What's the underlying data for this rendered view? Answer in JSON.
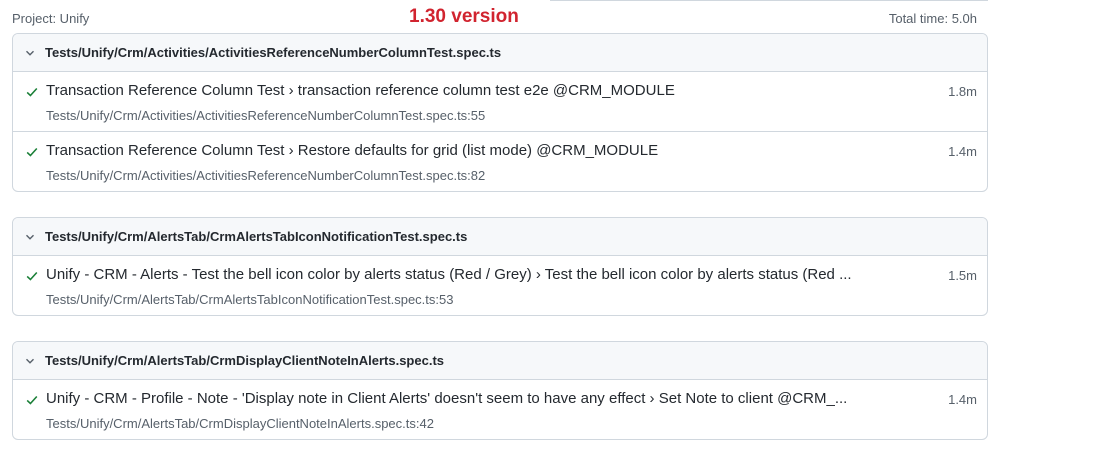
{
  "header": {
    "project": "Project: Unify",
    "version": "1.30 version",
    "total_time": "Total time: 5.0h"
  },
  "colors": {
    "pass": "#1a7f37",
    "version": "#d1242f"
  },
  "files": [
    {
      "title": "Tests/Unify/Crm/Activities/ActivitiesReferenceNumberColumnTest.spec.ts",
      "expanded_icon": "chevron-down-icon",
      "tests": [
        {
          "status_icon": "check-icon",
          "title": "Transaction Reference Column Test › transaction reference column test e2e @CRM_MODULE",
          "location": "Tests/Unify/Crm/Activities/ActivitiesReferenceNumberColumnTest.spec.ts:55",
          "duration": "1.8m"
        },
        {
          "status_icon": "check-icon",
          "title": "Transaction Reference Column Test › Restore defaults for grid (list mode) @CRM_MODULE",
          "location": "Tests/Unify/Crm/Activities/ActivitiesReferenceNumberColumnTest.spec.ts:82",
          "duration": "1.4m"
        }
      ]
    },
    {
      "title": "Tests/Unify/Crm/AlertsTab/CrmAlertsTabIconNotificationTest.spec.ts",
      "expanded_icon": "chevron-down-icon",
      "tests": [
        {
          "status_icon": "check-icon",
          "title": "Unify - CRM - Alerts - Test the bell icon color by alerts status (Red / Grey) › Test the bell icon color by alerts status (Red ...",
          "location": "Tests/Unify/Crm/AlertsTab/CrmAlertsTabIconNotificationTest.spec.ts:53",
          "duration": "1.5m"
        }
      ]
    },
    {
      "title": "Tests/Unify/Crm/AlertsTab/CrmDisplayClientNoteInAlerts.spec.ts",
      "expanded_icon": "chevron-down-icon",
      "tests": [
        {
          "status_icon": "check-icon",
          "title": "Unify - CRM - Profile - Note - 'Display note in Client Alerts' doesn't seem to have any effect › Set Note to client @CRM_...",
          "location": "Tests/Unify/Crm/AlertsTab/CrmDisplayClientNoteInAlerts.spec.ts:42",
          "duration": "1.4m"
        }
      ]
    }
  ]
}
